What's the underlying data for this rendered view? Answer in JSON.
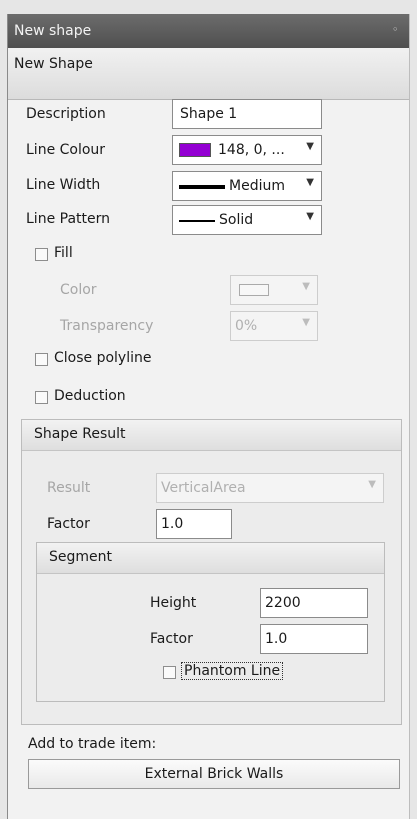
{
  "panel": {
    "title": "New shape",
    "pin_icon": "pin-icon",
    "subheader": "New Shape"
  },
  "form": {
    "description": {
      "label": "Description",
      "value": "Shape 1"
    },
    "line_colour": {
      "label": "Line Colour",
      "value": "148, 0, ...",
      "color": "#9400D3"
    },
    "line_width": {
      "label": "Line Width",
      "value": "Medium"
    },
    "line_pattern": {
      "label": "Line Pattern",
      "value": "Solid"
    },
    "fill": {
      "label": "Fill",
      "checked": false
    },
    "fill_color": {
      "label": "Color"
    },
    "transparency": {
      "label": "Transparency",
      "value": "0%"
    },
    "close_polyline": {
      "label": "Close polyline",
      "checked": false
    },
    "deduction": {
      "label": "Deduction",
      "checked": false
    }
  },
  "shape_result": {
    "title": "Shape Result",
    "result": {
      "label": "Result",
      "value": "VerticalArea"
    },
    "factor": {
      "label": "Factor",
      "value": "1.0"
    },
    "segment": {
      "title": "Segment",
      "height": {
        "label": "Height",
        "value": "2200"
      },
      "factor": {
        "label": "Factor",
        "value": "1.0"
      },
      "phantom_line": {
        "label": "Phantom Line",
        "checked": false
      }
    }
  },
  "trade": {
    "label": "Add to trade item:",
    "button": "External Brick Walls"
  }
}
